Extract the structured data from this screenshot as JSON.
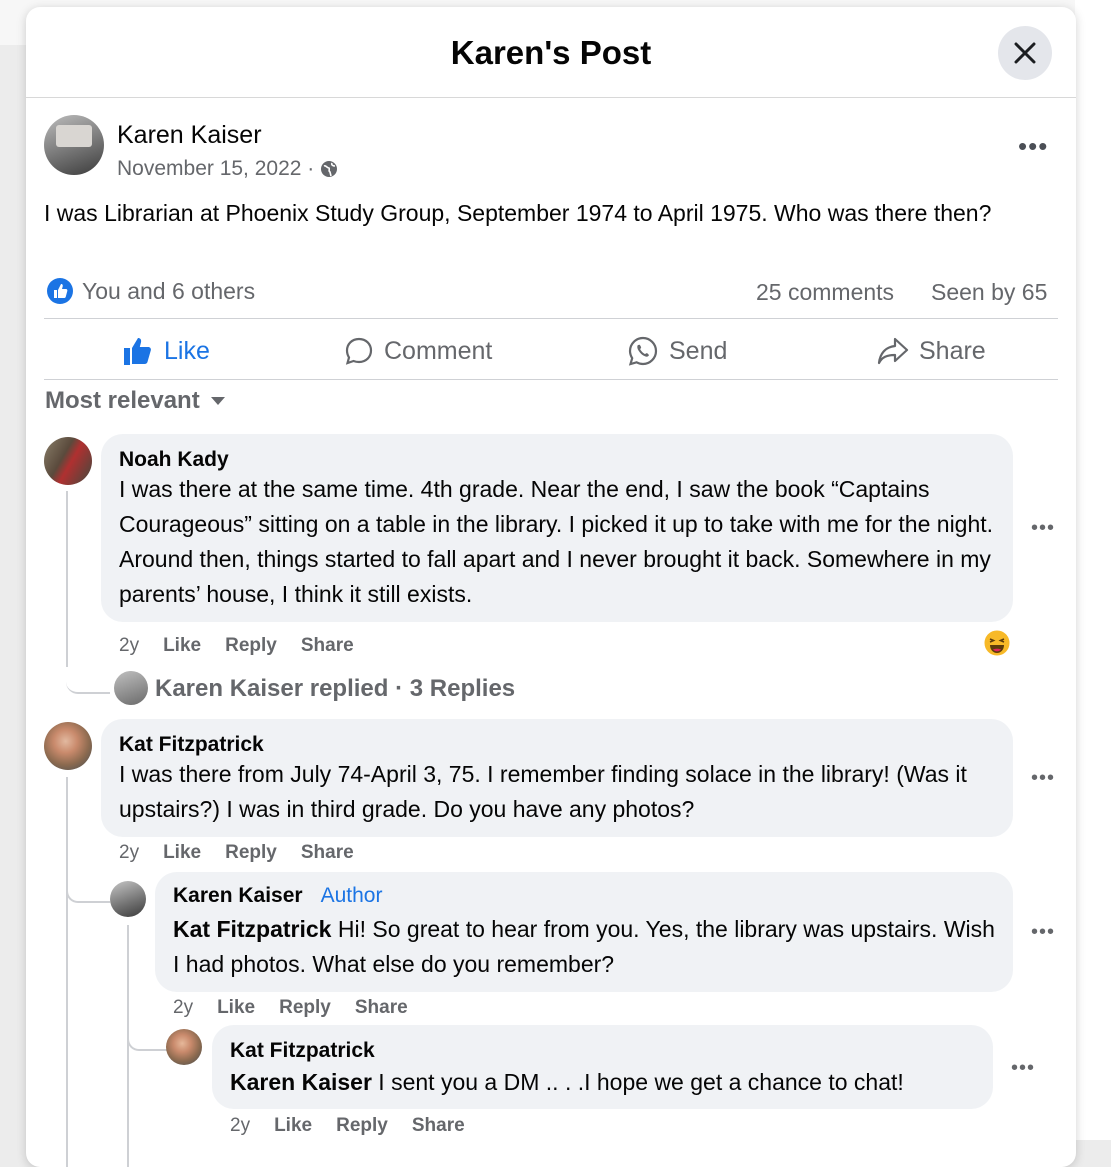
{
  "modal": {
    "title": "Karen's Post"
  },
  "post": {
    "author": "Karen Kaiser",
    "date": "November 15, 2022 ·",
    "audience_icon": "globe-icon",
    "text": "I was Librarian at Phoenix Study Group, September 1974 to April 1975. Who was there then?",
    "reactions": "You and 6 others",
    "comments_count": "25 comments",
    "seen_by": "Seen by 65",
    "actions": {
      "like": "Like",
      "comment": "Comment",
      "send": "Send",
      "share": "Share"
    }
  },
  "sort": {
    "label": "Most relevant"
  },
  "comments": [
    {
      "name": "Noah Kady",
      "text": "I was there at the same time. 4th grade. Near the end, I saw the book “Captains Courageous” sitting on a table in the library. I picked it up to take with me for the night. Around then, things started to fall apart and I never brought it back. Somewhere in my parents’ house, I think it still exists.",
      "time": "2y",
      "like": "Like",
      "reply": "Reply",
      "share": "Share",
      "reaction_icon": "laughing-emoji-icon",
      "replies_summary": "Karen Kaiser replied · 3 Replies"
    },
    {
      "name": "Kat Fitzpatrick",
      "text": "I was there from July 74-April 3, 75. I remember finding solace in the library! (Was it upstairs?) I was in third grade. Do you have any photos?",
      "time": "2y",
      "like": "Like",
      "reply": "Reply",
      "share": "Share"
    }
  ],
  "replies": [
    {
      "name": "Karen Kaiser",
      "badge": "Author",
      "mention": "Kat Fitzpatrick",
      "text": " Hi! So great to hear from you. Yes, the library was upstairs. Wish I had photos. What else do you remember?",
      "time": "2y",
      "like": "Like",
      "reply": "Reply",
      "share": "Share"
    },
    {
      "name": "Kat Fitzpatrick",
      "mention": "Karen Kaiser",
      "text": " I sent you a DM .. . .I hope we get a chance to chat!",
      "time": "2y",
      "like": "Like",
      "reply": "Reply",
      "share": "Share"
    }
  ],
  "colors": {
    "accent": "#1b74e4",
    "bubble": "#f0f2f5",
    "muted": "#65676b"
  }
}
